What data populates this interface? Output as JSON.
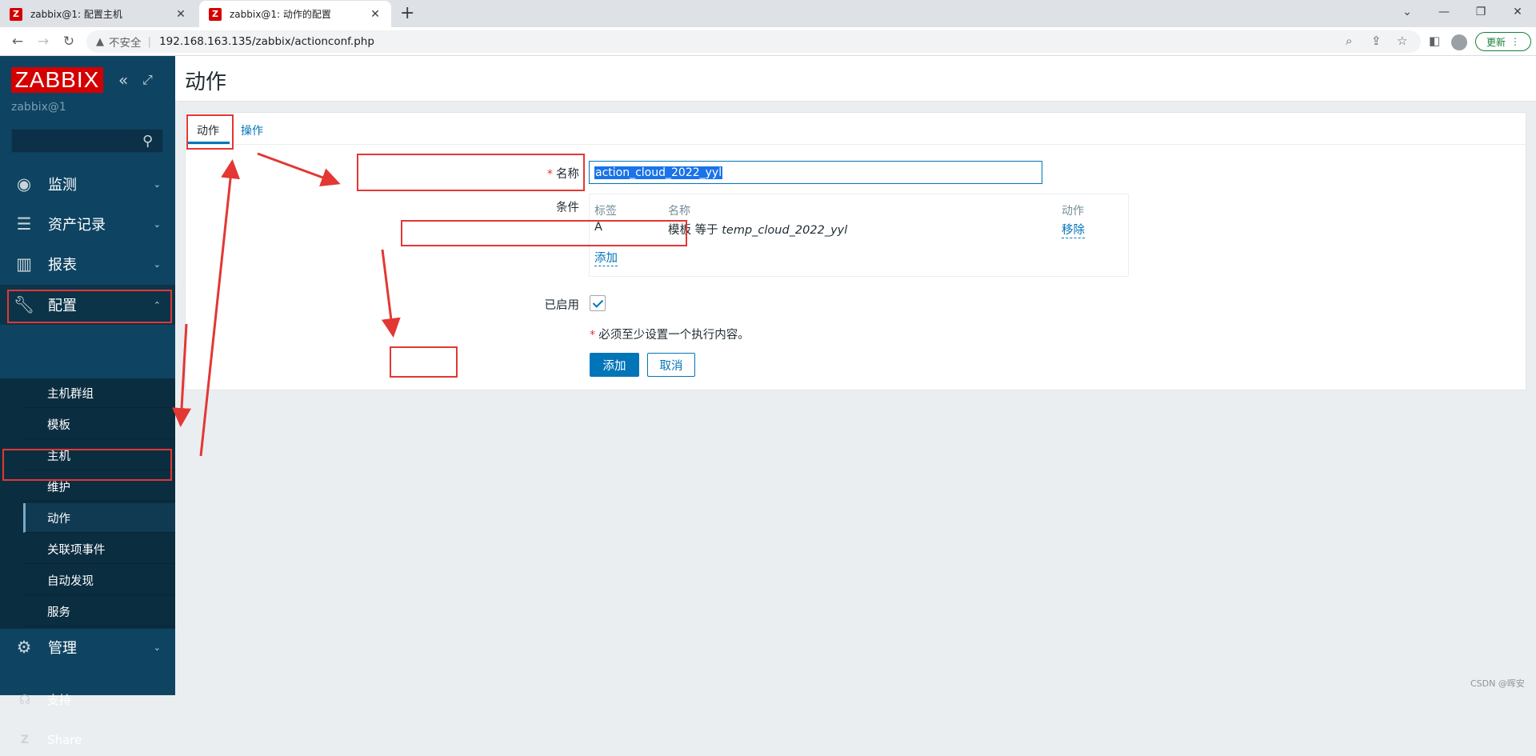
{
  "browser": {
    "tabs": [
      {
        "title": "zabbix@1: 配置主机",
        "active": false
      },
      {
        "title": "zabbix@1: 动作的配置",
        "active": true
      }
    ],
    "security_label": "不安全",
    "url": "192.168.163.135/zabbix/actionconf.php",
    "update_label": "更新"
  },
  "sidebar": {
    "logo": "ZABBIX",
    "server_name": "zabbix@1",
    "search_placeholder": "",
    "menu": [
      {
        "label": "监测",
        "icon": "eye-icon",
        "expanded": false
      },
      {
        "label": "资产记录",
        "icon": "list-icon",
        "expanded": false
      },
      {
        "label": "报表",
        "icon": "bar-chart-icon",
        "expanded": false
      },
      {
        "label": "配置",
        "icon": "wrench-icon",
        "expanded": true
      },
      {
        "label": "管理",
        "icon": "gear-icon",
        "expanded": false
      }
    ],
    "submenu": [
      {
        "label": "主机群组",
        "active": false
      },
      {
        "label": "模板",
        "active": false
      },
      {
        "label": "主机",
        "active": false
      },
      {
        "label": "维护",
        "active": false
      },
      {
        "label": "动作",
        "active": true
      },
      {
        "label": "关联项事件",
        "active": false
      },
      {
        "label": "自动发现",
        "active": false
      },
      {
        "label": "服务",
        "active": false
      }
    ],
    "bottom": [
      {
        "label": "支持",
        "icon": "headset-icon"
      },
      {
        "label": "Share",
        "icon": "zabbix-share-icon"
      }
    ]
  },
  "page": {
    "title": "动作",
    "tabs": [
      {
        "label": "动作",
        "active": true
      },
      {
        "label": "操作",
        "active": false
      }
    ],
    "form": {
      "name_label": "名称",
      "name_value": "action_cloud_2022_yyl",
      "conditions_label": "条件",
      "conditions_headers": {
        "label": "标签",
        "name": "名称",
        "action": "动作"
      },
      "conditions": [
        {
          "label": "A",
          "name_prefix": "模板 等于 ",
          "name_value": "temp_cloud_2022_yyl",
          "action": "移除"
        }
      ],
      "add_condition_link": "添加",
      "enabled_label": "已启用",
      "enabled": true,
      "note": "必须至少设置一个执行内容。",
      "add_button": "添加",
      "cancel_button": "取消"
    }
  },
  "watermark": "CSDN @晖安",
  "colors": {
    "accent": "#0275b8",
    "sidebar": "#0e4462",
    "logo": "#d40000",
    "annotation": "#e33734"
  }
}
